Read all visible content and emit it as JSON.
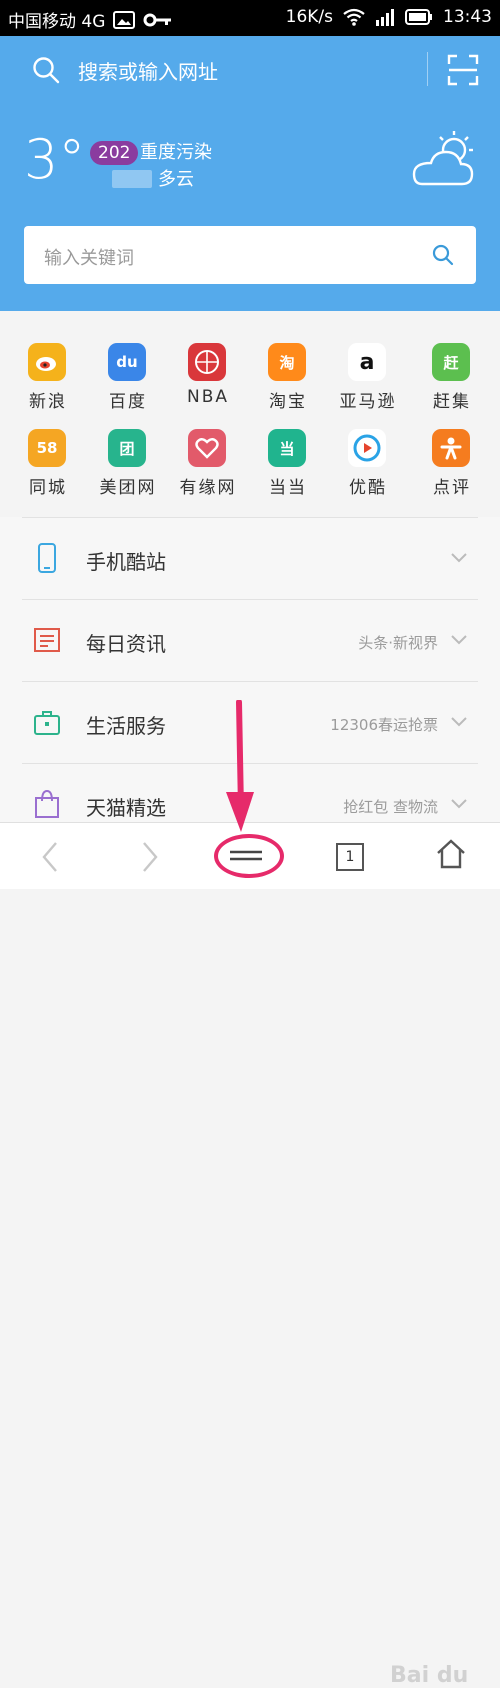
{
  "status_bar": {
    "carrier": "中国移动 4G",
    "speed": "16K/s",
    "time": "13:43"
  },
  "search": {
    "placeholder": "搜索或输入网址"
  },
  "weather": {
    "temperature": "3°",
    "aqi_value": "202",
    "aqi_label": "重度污染",
    "condition": "多云"
  },
  "keyword_search": {
    "placeholder": "输入关键词"
  },
  "sites": [
    {
      "label": "新浪",
      "icon": "sina-weibo-icon",
      "color": "#f5b21b"
    },
    {
      "label": "百度",
      "icon": "baidu-icon",
      "color": "#3a86e8"
    },
    {
      "label": "NBA",
      "icon": "basketball-icon",
      "color": "#d9373b"
    },
    {
      "label": "淘宝",
      "icon": "taobao-icon",
      "color": "#ff8a1a"
    },
    {
      "label": "亚马逊",
      "icon": "amazon-icon",
      "color": "#ffffff"
    },
    {
      "label": "赶集",
      "icon": "ganji-icon",
      "color": "#5cbf4f"
    },
    {
      "label": "同城",
      "icon": "58-icon",
      "color": "#f5a623"
    },
    {
      "label": "美团网",
      "icon": "meituan-icon",
      "color": "#27b48d"
    },
    {
      "label": "有缘网",
      "icon": "heart-icon",
      "color": "#e25a6a"
    },
    {
      "label": "当当",
      "icon": "dangdang-icon",
      "color": "#20b48e"
    },
    {
      "label": "优酷",
      "icon": "youku-icon",
      "color": "#ffffff"
    },
    {
      "label": "点评",
      "icon": "dianping-icon",
      "color": "#f57c1f"
    }
  ],
  "site_icon_text": [
    "",
    "du",
    "",
    "淘",
    "a",
    "赶",
    "58",
    "团",
    "",
    "当",
    "",
    ""
  ],
  "list": [
    {
      "title": "手机酷站",
      "sub": "",
      "icon": "phone-icon",
      "color": "#3ba7e0"
    },
    {
      "title": "每日资讯",
      "sub": "头条·新视界",
      "icon": "news-icon",
      "color": "#e05a4a"
    },
    {
      "title": "生活服务",
      "sub": "12306春运抢票",
      "icon": "briefcase-icon",
      "color": "#2db38c"
    },
    {
      "title": "天猫精选",
      "sub": "抢红包 查物流",
      "icon": "shopping-bag-icon",
      "color": "#9a6fd0"
    }
  ],
  "bottom": {
    "tab_count": "1",
    "watermark": "Bai du"
  }
}
